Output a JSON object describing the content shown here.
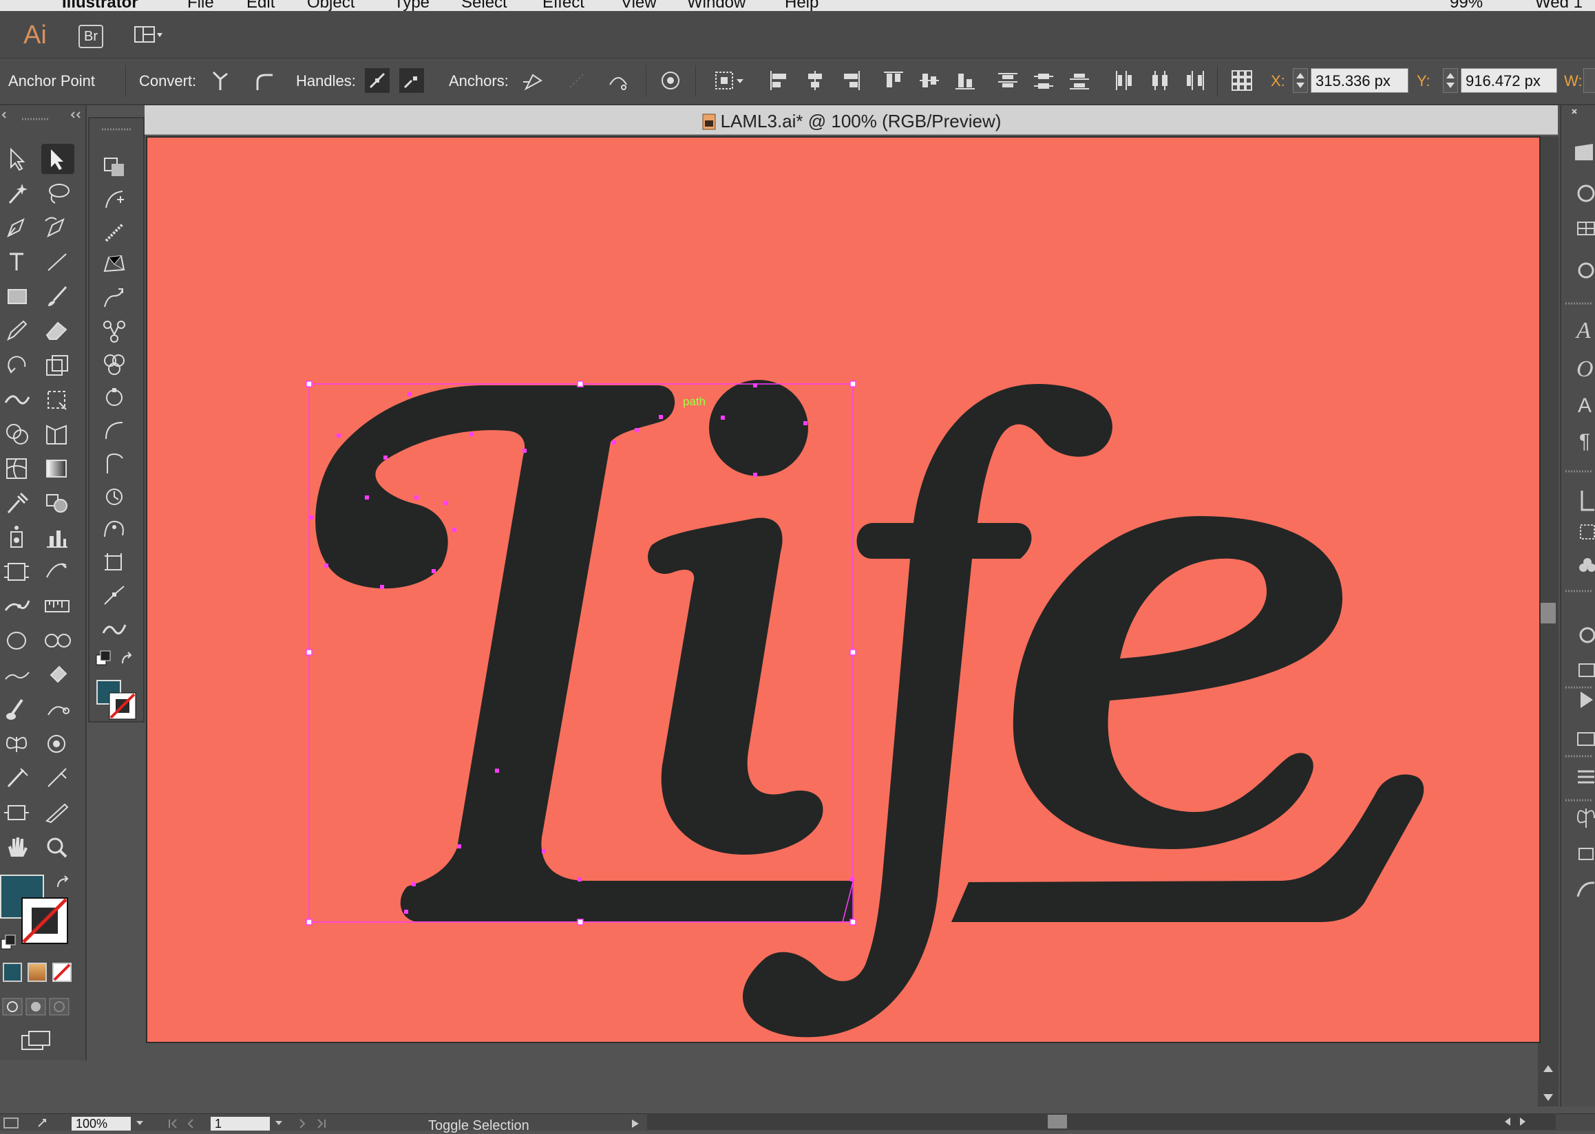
{
  "menubar": {
    "app_name": "Illustrator",
    "items": [
      "File",
      "Edit",
      "Object",
      "Type",
      "Select",
      "Effect",
      "View",
      "Window",
      "Help"
    ],
    "battery": "99%",
    "clock": "Wed 1"
  },
  "appbar": {
    "logo": "Ai",
    "bridge_label": "Br"
  },
  "controlbar": {
    "selection_type": "Anchor Point",
    "convert_label": "Convert:",
    "handles_label": "Handles:",
    "anchors_label": "Anchors:",
    "x_label": "X:",
    "x_value": "315.336 px",
    "y_label": "Y:",
    "y_value": "916.472 px",
    "w_label": "W:"
  },
  "document": {
    "title": "LAML3.ai* @ 100% (RGB/Preview)",
    "hover_label": "path",
    "artwork_text": "Life"
  },
  "status": {
    "zoom": "100%",
    "page": "1",
    "tool_hint": "Toggle Selection"
  },
  "colors": {
    "artboard": "#f86f5d",
    "letter_fill": "#232625",
    "selection": "#ff3cff",
    "fill_swatch": "#215563",
    "hover_label": "#9cff49"
  }
}
